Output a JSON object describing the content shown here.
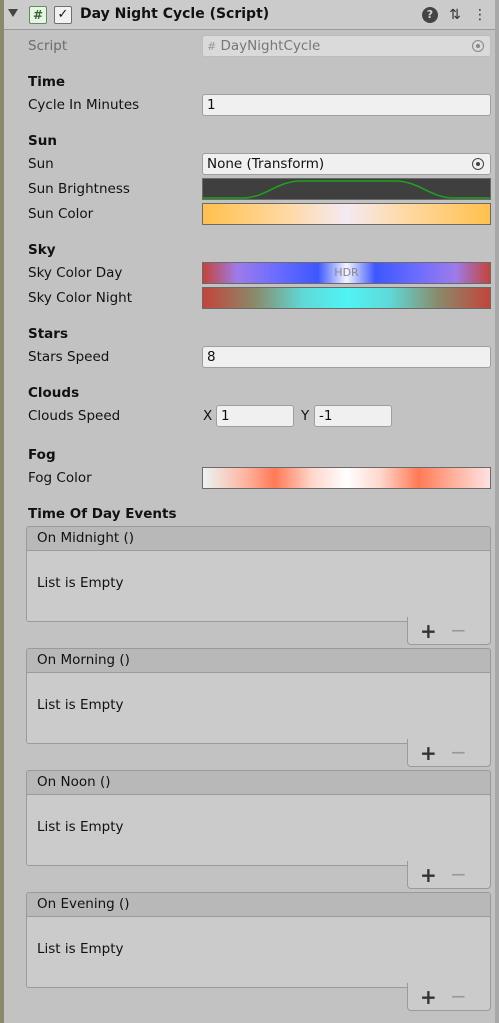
{
  "component": {
    "title": "Day Night Cycle (Script)",
    "script_label": "Script",
    "script_value": "DayNightCycle",
    "enabled_check": "✓"
  },
  "header_icons": {
    "help": "?",
    "settings": "⇅",
    "more": "⋮"
  },
  "time": {
    "header": "Time",
    "cycle_label": "Cycle In Minutes",
    "cycle_value": "1"
  },
  "sun": {
    "header": "Sun",
    "sun_label": "Sun",
    "sun_value": "None (Transform)",
    "brightness_label": "Sun Brightness",
    "color_label": "Sun Color"
  },
  "sky": {
    "header": "Sky",
    "day_label": "Sky Color Day",
    "day_badge": "HDR",
    "night_label": "Sky Color Night"
  },
  "stars": {
    "header": "Stars",
    "speed_label": "Stars Speed",
    "speed_value": "8"
  },
  "clouds": {
    "header": "Clouds",
    "speed_label": "Clouds Speed",
    "x_label": "X",
    "x_value": "1",
    "y_label": "Y",
    "y_value": "-1"
  },
  "fog": {
    "header": "Fog",
    "color_label": "Fog Color"
  },
  "events": {
    "header": "Time Of Day Events",
    "plus": "+",
    "minus": "−",
    "items": [
      {
        "name": "On Midnight ()",
        "empty": "List is Empty"
      },
      {
        "name": "On Morning ()",
        "empty": "List is Empty"
      },
      {
        "name": "On Noon ()",
        "empty": "List is Empty"
      },
      {
        "name": "On Evening ()",
        "empty": "List is Empty"
      }
    ]
  },
  "colors": {
    "panel_bg": "#c2c2c2",
    "curve_line": "#1fa21f",
    "sun_color_gradient": [
      "#ffc04d",
      "#f4eaf2",
      "#ffc04d"
    ],
    "sky_day_gradient": [
      "#c4443a",
      "#9d7bea",
      "#3d57ff",
      "#f4f4ff",
      "#3d57ff",
      "#9d7bea",
      "#c4443a"
    ],
    "sky_night_gradient": [
      "#c4443a",
      "#5fd9d8",
      "#4ff4f4",
      "#5fd9d8",
      "#c4443a"
    ],
    "fog_gradient": [
      "#eaf4f2",
      "#ff7a55",
      "#ffffff",
      "#ff7a55",
      "#ffe2e2"
    ]
  }
}
